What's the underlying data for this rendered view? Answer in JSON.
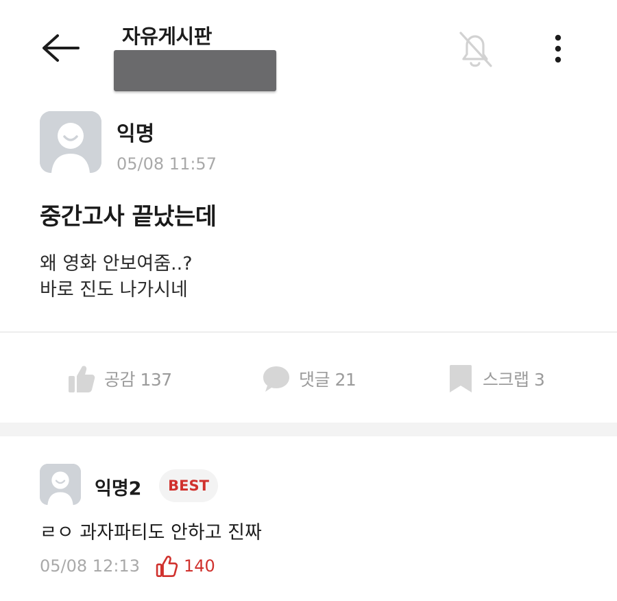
{
  "header": {
    "board_title": "자유게시판",
    "back_icon": "arrow-left-icon",
    "notification_icon": "bell-off-icon",
    "more_icon": "more-vertical-icon"
  },
  "post": {
    "author": "익명",
    "time": "05/08 11:57",
    "title": "중간고사 끝났는데",
    "body_lines": [
      "왜 영화 안보여줌..?",
      "바로 진도 나가시네"
    ]
  },
  "actions": {
    "like_label": "공감 137",
    "comment_label": "댓글 21",
    "scrap_label": "스크랩 3"
  },
  "comment": {
    "author": "익명2",
    "badge": "BEST",
    "body": "ㄹㅇ 과자파티도 안하고 진짜",
    "time": "05/08 12:13",
    "like_count": "140"
  },
  "colors": {
    "accent_red": "#d0312d",
    "muted_gray": "#a9a9a9",
    "icon_gray": "#d6d6d6"
  }
}
